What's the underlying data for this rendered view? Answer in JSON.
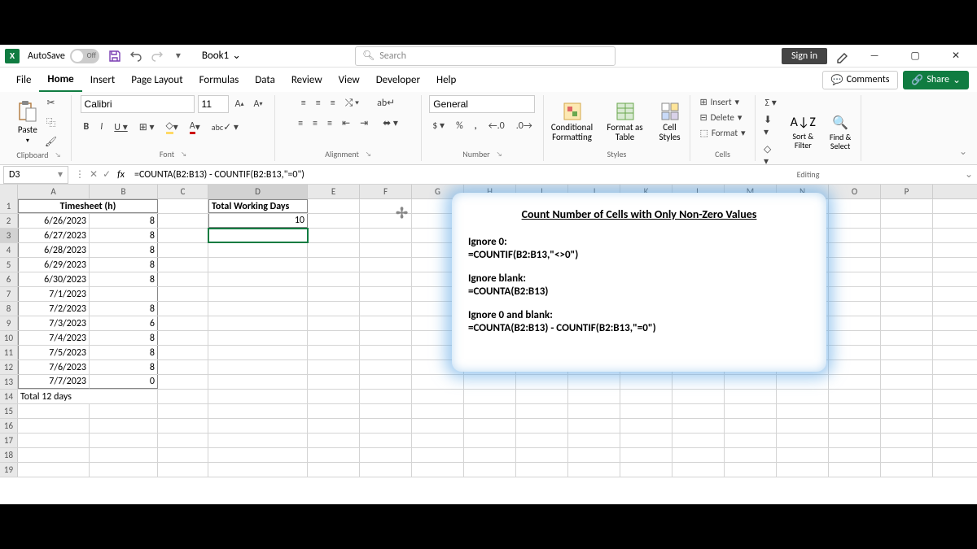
{
  "titlebar": {
    "autosave_label": "AutoSave",
    "autosave_state": "Off",
    "book_name": "Book1",
    "search_placeholder": "Search",
    "signin": "Sign in"
  },
  "tabs": {
    "file": "File",
    "home": "Home",
    "insert": "Insert",
    "page_layout": "Page Layout",
    "formulas": "Formulas",
    "data": "Data",
    "review": "Review",
    "view": "View",
    "developer": "Developer",
    "help": "Help",
    "comments": "Comments",
    "share": "Share"
  },
  "ribbon": {
    "paste": "Paste",
    "font_name": "Calibri",
    "font_size": "11",
    "number_format": "General",
    "conditional_formatting": "Conditional Formatting",
    "format_as_table": "Format as Table",
    "cell_styles": "Cell Styles",
    "insert": "Insert",
    "delete": "Delete",
    "format": "Format",
    "sort_filter": "Sort & Filter",
    "find_select": "Find & Select",
    "groups": {
      "clipboard": "Clipboard",
      "font": "Font",
      "alignment": "Alignment",
      "number": "Number",
      "styles": "Styles",
      "cells": "Cells",
      "editing": "Editing"
    }
  },
  "formula_bar": {
    "cell_ref": "D3",
    "formula": "=COUNTA(B2:B13) - COUNTIF(B2:B13,\"=0\")"
  },
  "columns": [
    "A",
    "B",
    "C",
    "D",
    "E",
    "F",
    "G",
    "H",
    "I",
    "J",
    "K",
    "L",
    "M",
    "N",
    "O",
    "P"
  ],
  "sheet": {
    "header_a": "Timesheet (h)",
    "header_d": "Total Working Days",
    "result_d2": "10",
    "total_row": "Total 12 days",
    "rows": [
      {
        "date": "6/26/2023",
        "hours": "8"
      },
      {
        "date": "6/27/2023",
        "hours": "8"
      },
      {
        "date": "6/28/2023",
        "hours": "8"
      },
      {
        "date": "6/29/2023",
        "hours": "8"
      },
      {
        "date": "6/30/2023",
        "hours": "8"
      },
      {
        "date": "7/1/2023",
        "hours": ""
      },
      {
        "date": "7/2/2023",
        "hours": "8"
      },
      {
        "date": "7/3/2023",
        "hours": "6"
      },
      {
        "date": "7/4/2023",
        "hours": "8"
      },
      {
        "date": "7/5/2023",
        "hours": "8"
      },
      {
        "date": "7/6/2023",
        "hours": "8"
      },
      {
        "date": "7/7/2023",
        "hours": "0"
      }
    ]
  },
  "callout": {
    "title": "Count Number of Cells with Only Non-Zero Values",
    "b1_label": "Ignore 0:",
    "b1_formula": "=COUNTIF(B2:B13,\"<>0\")",
    "b2_label": "Ignore blank:",
    "b2_formula": "=COUNTA(B2:B13)",
    "b3_label": "Ignore 0 and blank:",
    "b3_formula": "=COUNTA(B2:B13) - COUNTIF(B2:B13,\"=0\")"
  }
}
